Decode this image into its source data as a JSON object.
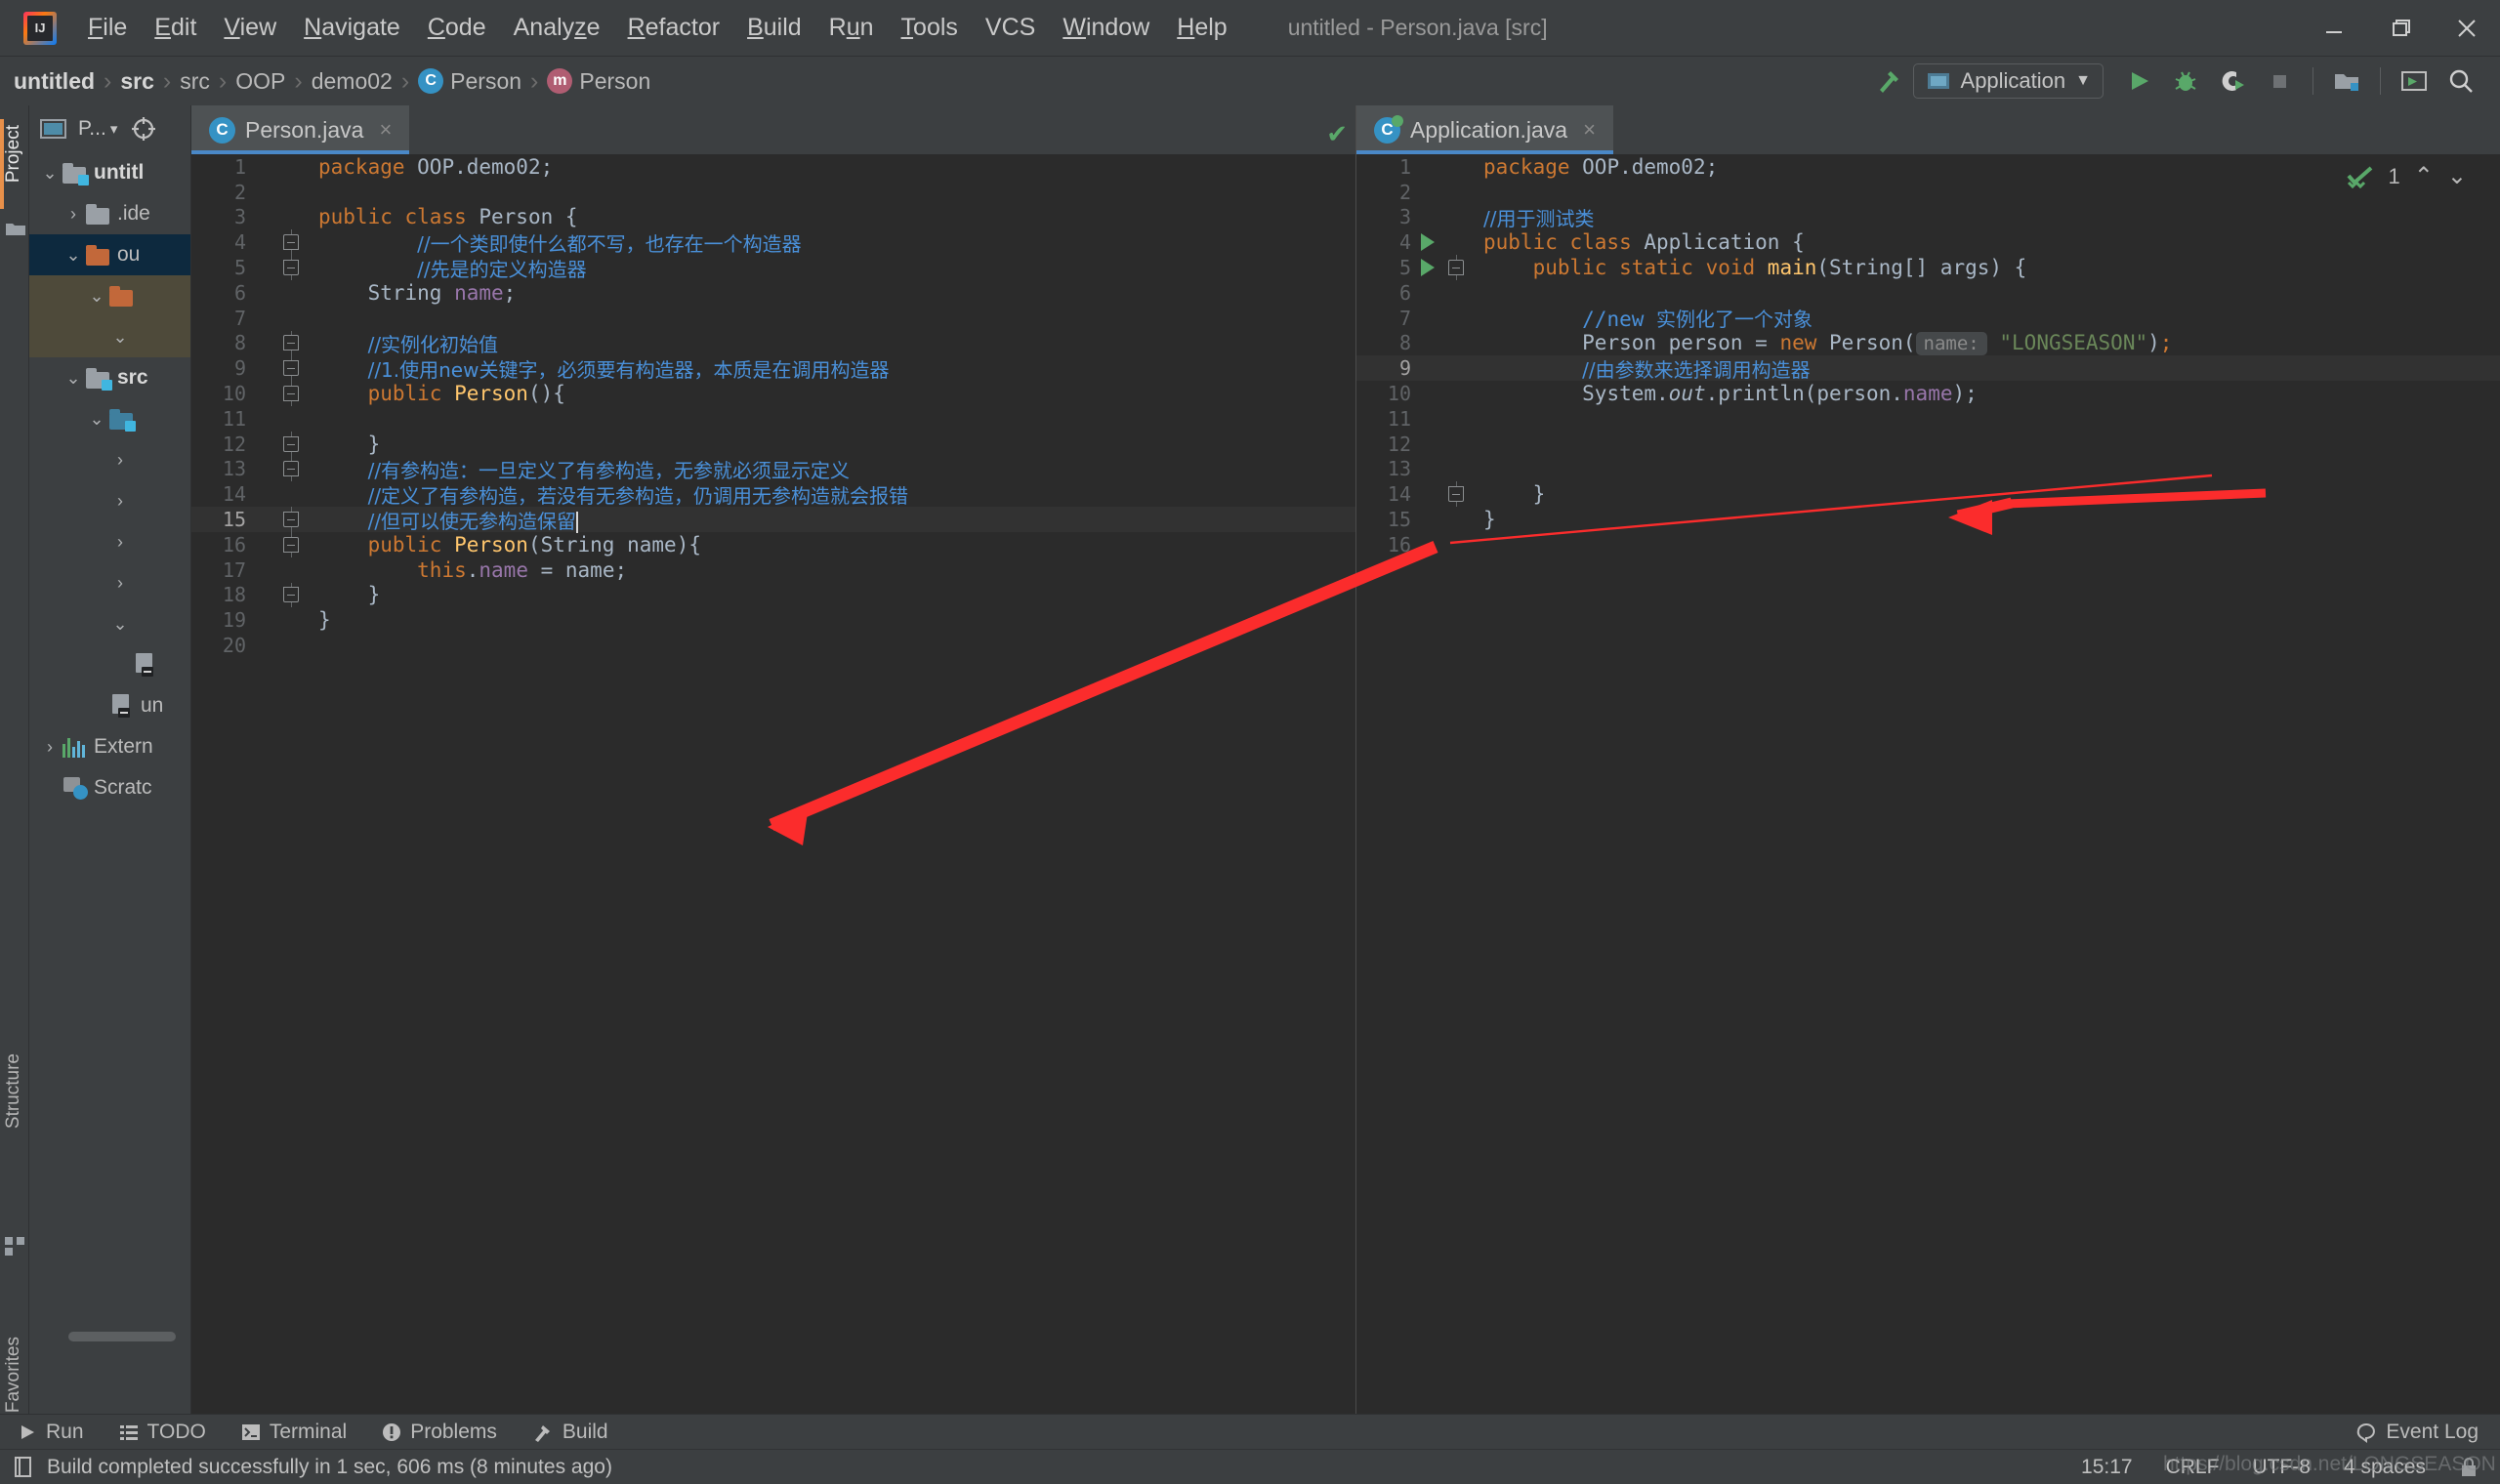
{
  "window": {
    "title": "untitled - Person.java [src]",
    "logo": "intellij-idea-logo"
  },
  "menubar": {
    "items": [
      {
        "label": "File",
        "mnemonic": "F"
      },
      {
        "label": "Edit",
        "mnemonic": "E"
      },
      {
        "label": "View",
        "mnemonic": "V"
      },
      {
        "label": "Navigate",
        "mnemonic": "N"
      },
      {
        "label": "Code",
        "mnemonic": "C"
      },
      {
        "label": "Analyze",
        "mnemonic": "z"
      },
      {
        "label": "Refactor",
        "mnemonic": "R"
      },
      {
        "label": "Build",
        "mnemonic": "B"
      },
      {
        "label": "Run",
        "mnemonic": "u"
      },
      {
        "label": "Tools",
        "mnemonic": "T"
      },
      {
        "label": "VCS",
        "mnemonic": ""
      },
      {
        "label": "Window",
        "mnemonic": "W"
      },
      {
        "label": "Help",
        "mnemonic": "H"
      }
    ],
    "window_controls": [
      "minimize",
      "restore",
      "close"
    ]
  },
  "breadcrumb": {
    "items": [
      {
        "label": "untitled",
        "icon": "",
        "bold": true
      },
      {
        "label": "src",
        "icon": "",
        "bold": true
      },
      {
        "label": "src",
        "icon": "",
        "bold": false
      },
      {
        "label": "OOP",
        "icon": "",
        "bold": false
      },
      {
        "label": "demo02",
        "icon": "",
        "bold": false
      },
      {
        "label": "Person",
        "icon": "class-icon",
        "bold": false
      },
      {
        "label": "Person",
        "icon": "method-icon",
        "bold": false
      }
    ],
    "separator": "›"
  },
  "toolbar": {
    "build_label": "build-hammer-icon",
    "run_config": "Application",
    "run_config_dropdown": "▼",
    "buttons": [
      {
        "name": "run-button",
        "glyph": "▶"
      },
      {
        "name": "debug-button",
        "glyph": "debug-bug-icon"
      },
      {
        "name": "run-with-coverage-button",
        "glyph": "coverage-icon"
      },
      {
        "name": "stop-button",
        "glyph": "■"
      },
      {
        "name": "project-structure-button",
        "glyph": "folder-icon"
      },
      {
        "name": "open-preview-button",
        "glyph": "window-icon"
      },
      {
        "name": "search-everywhere-button",
        "glyph": "search-icon"
      }
    ]
  },
  "left_tool_strip": {
    "tabs": [
      {
        "label": "Project",
        "active": true
      },
      {
        "label": "Structure",
        "active": false
      },
      {
        "label": "Favorites",
        "active": false
      }
    ]
  },
  "project_panel": {
    "title": "P...",
    "title_dropdown": "▾",
    "locate_icon": "crosshair-icon",
    "tree": [
      {
        "label": "untitl",
        "depth": 0,
        "twisty": "⌄",
        "icon": "module-folder",
        "bold": true,
        "state": "normal"
      },
      {
        "label": ".ide",
        "depth": 1,
        "twisty": "›",
        "icon": "folder-gray",
        "bold": false,
        "state": "normal"
      },
      {
        "label": "ou",
        "depth": 1,
        "twisty": "⌄",
        "icon": "folder-orange",
        "bold": false,
        "state": "selected"
      },
      {
        "label": "",
        "depth": 2,
        "twisty": "⌄",
        "icon": "folder-orange",
        "bold": false,
        "state": "highlight"
      },
      {
        "label": "",
        "depth": 3,
        "twisty": "⌄",
        "icon": "",
        "bold": false,
        "state": "highlight"
      },
      {
        "label": "src",
        "depth": 1,
        "twisty": "⌄",
        "icon": "folder-source",
        "bold": true,
        "state": "normal"
      },
      {
        "label": "",
        "depth": 2,
        "twisty": "⌄",
        "icon": "folder-blue",
        "bold": false,
        "state": "normal"
      },
      {
        "label": "",
        "depth": 3,
        "twisty": "›",
        "icon": "",
        "bold": false,
        "state": "normal"
      },
      {
        "label": "",
        "depth": 3,
        "twisty": "›",
        "icon": "",
        "bold": false,
        "state": "normal"
      },
      {
        "label": "",
        "depth": 3,
        "twisty": "›",
        "icon": "",
        "bold": false,
        "state": "normal"
      },
      {
        "label": "",
        "depth": 3,
        "twisty": "›",
        "icon": "",
        "bold": false,
        "state": "normal"
      },
      {
        "label": "",
        "depth": 3,
        "twisty": "⌄",
        "icon": "",
        "bold": false,
        "state": "normal"
      },
      {
        "label": "",
        "depth": 3,
        "twisty": "",
        "icon": "jar-file",
        "bold": false,
        "state": "normal"
      },
      {
        "label": "un",
        "depth": 2,
        "twisty": "",
        "icon": "jar-file",
        "bold": false,
        "state": "normal"
      },
      {
        "label": "Extern",
        "depth": 0,
        "twisty": "›",
        "icon": "libraries",
        "bold": false,
        "state": "normal"
      },
      {
        "label": "Scratc",
        "depth": 0,
        "twisty": "",
        "icon": "scratches",
        "bold": false,
        "state": "normal"
      }
    ]
  },
  "editors": [
    {
      "tab": {
        "label": "Person.java",
        "icon": "java-class-icon",
        "close": "×",
        "active": true
      },
      "status_check": "✔",
      "lines": [
        {
          "n": 1,
          "gutter": "",
          "fold": "",
          "tokens": [
            {
              "t": "package ",
              "c": "kw"
            },
            {
              "t": "OOP.demo02;",
              "c": "plain"
            }
          ]
        },
        {
          "n": 2,
          "gutter": "",
          "fold": "",
          "tokens": []
        },
        {
          "n": 3,
          "gutter": "",
          "fold": "",
          "tokens": [
            {
              "t": "public class ",
              "c": "kw"
            },
            {
              "t": "Person ",
              "c": "plain"
            },
            {
              "t": "{",
              "c": "plain"
            }
          ]
        },
        {
          "n": 4,
          "gutter": "",
          "fold": "start",
          "tokens": [
            {
              "t": "        ",
              "c": "plain"
            },
            {
              "t": "//一个类即使什么都不写，也存在一个构造器",
              "c": "cmt-cn"
            }
          ]
        },
        {
          "n": 5,
          "gutter": "",
          "fold": "end",
          "tokens": [
            {
              "t": "        ",
              "c": "plain"
            },
            {
              "t": "//先是的定义构造器",
              "c": "cmt-cn"
            }
          ]
        },
        {
          "n": 6,
          "gutter": "",
          "fold": "",
          "tokens": [
            {
              "t": "    ",
              "c": "plain"
            },
            {
              "t": "String ",
              "c": "plain"
            },
            {
              "t": "name",
              "c": "fld"
            },
            {
              "t": ";",
              "c": "plain"
            }
          ]
        },
        {
          "n": 7,
          "gutter": "",
          "fold": "",
          "tokens": []
        },
        {
          "n": 8,
          "gutter": "",
          "fold": "start",
          "tokens": [
            {
              "t": "    ",
              "c": "plain"
            },
            {
              "t": "//实例化初始值",
              "c": "cmt-cn"
            }
          ]
        },
        {
          "n": 9,
          "gutter": "",
          "fold": "end",
          "tokens": [
            {
              "t": "    ",
              "c": "plain"
            },
            {
              "t": "//1.使用new关键字，必须要有构造器，本质是在调用构造器",
              "c": "cmt-cn"
            }
          ]
        },
        {
          "n": 10,
          "gutter": "",
          "fold": "start",
          "tokens": [
            {
              "t": "    ",
              "c": "plain"
            },
            {
              "t": "public ",
              "c": "kw"
            },
            {
              "t": "Person",
              "c": "mname"
            },
            {
              "t": "(){",
              "c": "plain"
            }
          ]
        },
        {
          "n": 11,
          "gutter": "",
          "fold": "",
          "tokens": []
        },
        {
          "n": 12,
          "gutter": "",
          "fold": "end",
          "tokens": [
            {
              "t": "    }",
              "c": "plain"
            }
          ]
        },
        {
          "n": 13,
          "gutter": "",
          "fold": "start",
          "tokens": [
            {
              "t": "    ",
              "c": "plain"
            },
            {
              "t": "//有参构造：一旦定义了有参构造，无参就必须显示定义",
              "c": "cmt-cn"
            }
          ]
        },
        {
          "n": 14,
          "gutter": "",
          "fold": "",
          "tokens": [
            {
              "t": "    ",
              "c": "plain"
            },
            {
              "t": "//定义了有参构造，若没有无参构造，仍调用无参构造就会报错",
              "c": "cmt-cn"
            }
          ]
        },
        {
          "n": 15,
          "gutter": "bulb",
          "fold": "end",
          "current": true,
          "caret": true,
          "tokens": [
            {
              "t": "    ",
              "c": "plain"
            },
            {
              "t": "//但可以使无参构造保留",
              "c": "cmt-cn"
            }
          ]
        },
        {
          "n": 16,
          "gutter": "",
          "fold": "start",
          "tokens": [
            {
              "t": "    ",
              "c": "plain"
            },
            {
              "t": "public ",
              "c": "kw"
            },
            {
              "t": "Person",
              "c": "mname"
            },
            {
              "t": "(String ",
              "c": "plain"
            },
            {
              "t": "name",
              "c": "plain"
            },
            {
              "t": "){",
              "c": "plain"
            }
          ]
        },
        {
          "n": 17,
          "gutter": "",
          "fold": "",
          "tokens": [
            {
              "t": "        ",
              "c": "plain"
            },
            {
              "t": "this",
              "c": "kw"
            },
            {
              "t": ".",
              "c": "plain"
            },
            {
              "t": "name",
              "c": "fld"
            },
            {
              "t": " = name;",
              "c": "plain"
            }
          ]
        },
        {
          "n": 18,
          "gutter": "",
          "fold": "end",
          "tokens": [
            {
              "t": "    }",
              "c": "plain"
            }
          ]
        },
        {
          "n": 19,
          "gutter": "",
          "fold": "",
          "tokens": [
            {
              "t": "}",
              "c": "plain"
            }
          ]
        },
        {
          "n": 20,
          "gutter": "",
          "fold": "",
          "tokens": []
        }
      ]
    },
    {
      "tab": {
        "label": "Application.java",
        "icon": "java-runnable-class-icon",
        "close": "×",
        "active": true
      },
      "inspection": {
        "glyph": "✔",
        "count": "1",
        "prev": "⌃",
        "next": "⌄"
      },
      "lines": [
        {
          "n": 1,
          "gutter": "",
          "fold": "",
          "tokens": [
            {
              "t": "package ",
              "c": "kw"
            },
            {
              "t": "OOP.demo02;",
              "c": "plain"
            }
          ]
        },
        {
          "n": 2,
          "gutter": "",
          "fold": "",
          "tokens": []
        },
        {
          "n": 3,
          "gutter": "",
          "fold": "",
          "tokens": [
            {
              "t": "//用于测试类",
              "c": "cmt-cn"
            }
          ]
        },
        {
          "n": 4,
          "gutter": "run",
          "fold": "",
          "tokens": [
            {
              "t": "public class ",
              "c": "kw"
            },
            {
              "t": "Application ",
              "c": "plain"
            },
            {
              "t": "{",
              "c": "plain"
            }
          ]
        },
        {
          "n": 5,
          "gutter": "run",
          "fold": "start",
          "tokens": [
            {
              "t": "    ",
              "c": "plain"
            },
            {
              "t": "public static void ",
              "c": "kw"
            },
            {
              "t": "main",
              "c": "mname"
            },
            {
              "t": "(String[] args) {",
              "c": "plain"
            }
          ]
        },
        {
          "n": 6,
          "gutter": "",
          "fold": "",
          "tokens": []
        },
        {
          "n": 7,
          "gutter": "",
          "fold": "",
          "tokens": [
            {
              "t": "        ",
              "c": "plain"
            },
            {
              "t": "//new ",
              "c": "cmt"
            },
            {
              "t": "实例化了一个对象",
              "c": "cmt-cn"
            }
          ]
        },
        {
          "n": 8,
          "gutter": "",
          "fold": "",
          "hint": "name:",
          "str": "\"LONGSEASON\"",
          "tokens": [
            {
              "t": "        ",
              "c": "plain"
            },
            {
              "t": "Person person = ",
              "c": "plain"
            },
            {
              "t": "new ",
              "c": "kw"
            },
            {
              "t": "Person(",
              "c": "plain"
            }
          ]
        },
        {
          "n": 9,
          "gutter": "",
          "fold": "",
          "current": true,
          "tokens": [
            {
              "t": "        ",
              "c": "plain"
            },
            {
              "t": "//由参数来选择调用构造器",
              "c": "cmt-cn"
            }
          ]
        },
        {
          "n": 10,
          "gutter": "",
          "fold": "",
          "tokens": [
            {
              "t": "        ",
              "c": "plain"
            },
            {
              "t": "System.",
              "c": "plain"
            },
            {
              "t": "out",
              "c": "stat"
            },
            {
              "t": ".println(person.",
              "c": "plain"
            },
            {
              "t": "name",
              "c": "fld"
            },
            {
              "t": ");",
              "c": "plain"
            }
          ]
        },
        {
          "n": 11,
          "gutter": "",
          "fold": "",
          "tokens": []
        },
        {
          "n": 12,
          "gutter": "",
          "fold": "",
          "tokens": []
        },
        {
          "n": 13,
          "gutter": "",
          "fold": "",
          "tokens": []
        },
        {
          "n": 14,
          "gutter": "",
          "fold": "end",
          "tokens": [
            {
              "t": "    }",
              "c": "plain"
            }
          ]
        },
        {
          "n": 15,
          "gutter": "",
          "fold": "",
          "tokens": [
            {
              "t": "}",
              "c": "plain"
            }
          ]
        },
        {
          "n": 16,
          "gutter": "",
          "fold": "",
          "tokens": []
        }
      ]
    }
  ],
  "tool_windows": [
    {
      "label": "Run",
      "icon": "play-icon"
    },
    {
      "label": "TODO",
      "icon": "list-icon"
    },
    {
      "label": "Terminal",
      "icon": "terminal-icon"
    },
    {
      "label": "Problems",
      "icon": "problems-icon"
    },
    {
      "label": "Build",
      "icon": "hammer-icon"
    }
  ],
  "event_log": {
    "label": "Event Log",
    "icon": "balloon-icon"
  },
  "statusbar": {
    "message": "Build completed successfully in 1 sec, 606 ms (8 minutes ago)",
    "message_icon": "document-icon",
    "time": "15:17",
    "line_separator": "CRLF",
    "encoding": "UTF-8",
    "indent": "4 spaces",
    "lock_icon": "lock-icon"
  },
  "watermark": "https://blog.csdn.net/LONGSEASON",
  "colors": {
    "chrome": "#3c3f41",
    "editor_bg": "#2b2b2b",
    "accent_blue": "#4a88c7",
    "keyword_orange": "#cc7832",
    "comment_blue": "#4a90d9",
    "string_green": "#6a8759",
    "field_purple": "#9876aa",
    "method_yellow": "#ffc66d",
    "selection_blue": "#0d293e",
    "annotation_red": "#fb2c2c",
    "run_green": "#59a869"
  }
}
